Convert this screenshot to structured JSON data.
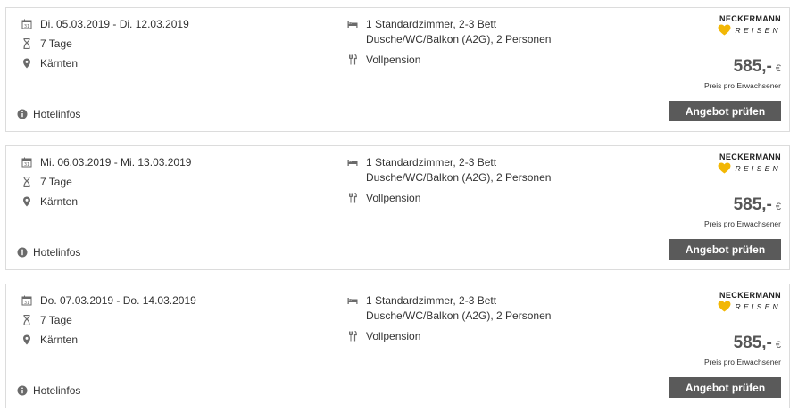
{
  "brand": {
    "name": "NECKERMANN",
    "sub": "REISEN",
    "heart_color": "#f2b705"
  },
  "offers": [
    {
      "dates": "Di. 05.03.2019 - Di. 12.03.2019",
      "duration": "7 Tage",
      "location": "Kärnten",
      "room_line1": "1 Standardzimmer, 2-3 Bett",
      "room_line2": "Dusche/WC/Balkon (A2G), 2 Personen",
      "board": "Vollpension",
      "price": "585,-",
      "currency": "€",
      "price_note": "Preis pro Erwachsener",
      "cta_label": "Angebot prüfen",
      "hotelinfo_label": "Hotelinfos"
    },
    {
      "dates": "Mi. 06.03.2019 - Mi. 13.03.2019",
      "duration": "7 Tage",
      "location": "Kärnten",
      "room_line1": "1 Standardzimmer, 2-3 Bett",
      "room_line2": "Dusche/WC/Balkon (A2G), 2 Personen",
      "board": "Vollpension",
      "price": "585,-",
      "currency": "€",
      "price_note": "Preis pro Erwachsener",
      "cta_label": "Angebot prüfen",
      "hotelinfo_label": "Hotelinfos"
    },
    {
      "dates": "Do. 07.03.2019 - Do. 14.03.2019",
      "duration": "7 Tage",
      "location": "Kärnten",
      "room_line1": "1 Standardzimmer, 2-3 Bett",
      "room_line2": "Dusche/WC/Balkon (A2G), 2 Personen",
      "board": "Vollpension",
      "price": "585,-",
      "currency": "€",
      "price_note": "Preis pro Erwachsener",
      "cta_label": "Angebot prüfen",
      "hotelinfo_label": "Hotelinfos"
    }
  ]
}
